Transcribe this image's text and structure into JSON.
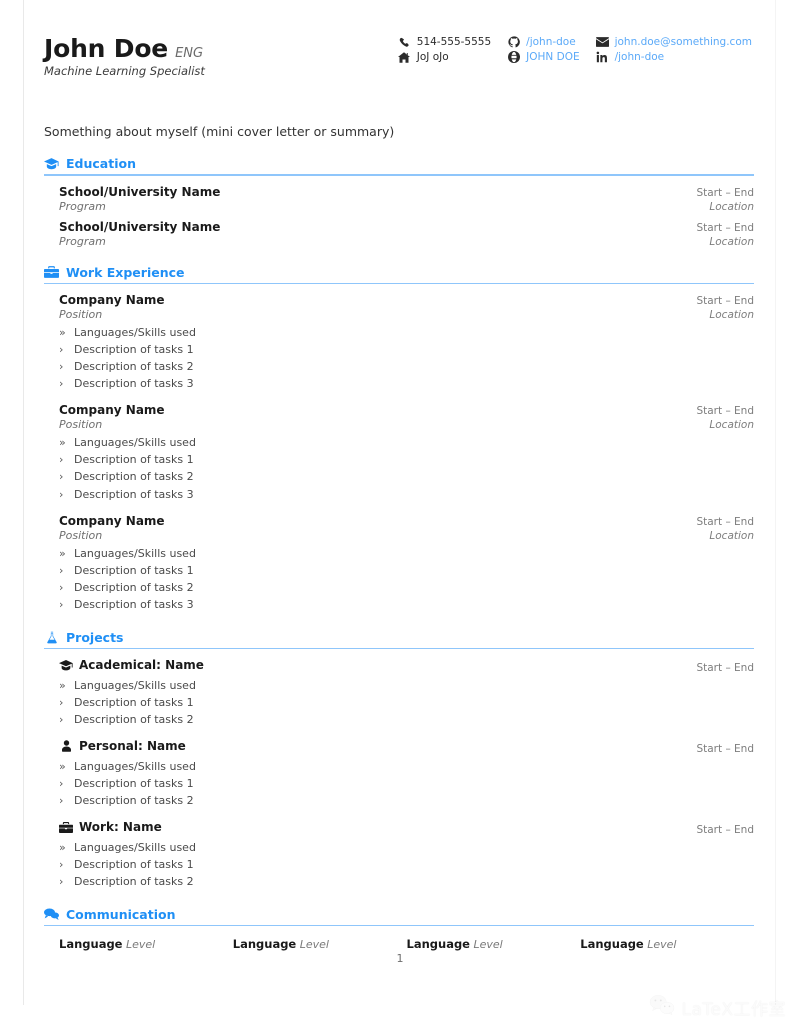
{
  "header": {
    "name": "John Doe",
    "name_tag": "ENG",
    "subtitle": "Machine Learning Specialist",
    "summary": "Something about myself (mini cover letter or summary)",
    "contacts": [
      {
        "icon": "phone-icon",
        "text": "514-555-5555",
        "style": "dark"
      },
      {
        "icon": "github-icon",
        "text": "/john-doe",
        "style": "link"
      },
      {
        "icon": "envelope-icon",
        "text": "john.doe@something.com",
        "style": "link"
      },
      {
        "icon": "home-icon",
        "text": "JoJ oJo",
        "style": "dark"
      },
      {
        "icon": "globe-icon",
        "text": "JOHN DOE",
        "style": "link"
      },
      {
        "icon": "linkedin-icon",
        "text": "/john-doe",
        "style": "link"
      }
    ]
  },
  "sections": {
    "education": {
      "icon": "graduation-cap-icon",
      "title": "Education",
      "entries": [
        {
          "title": "School/University Name",
          "role": "Program",
          "date": "Start – End",
          "location": "Location"
        },
        {
          "title": "School/University Name",
          "role": "Program",
          "date": "Start – End",
          "location": "Location"
        }
      ]
    },
    "work": {
      "icon": "briefcase-icon",
      "title": "Work Experience",
      "entries": [
        {
          "title": "Company Name",
          "role": "Position",
          "date": "Start – End",
          "location": "Location",
          "bullets": [
            {
              "mark": "»",
              "text": "Languages/Skills used"
            },
            {
              "mark": "›",
              "text": "Description of tasks 1"
            },
            {
              "mark": "›",
              "text": "Description of tasks 2"
            },
            {
              "mark": "›",
              "text": "Description of tasks 3"
            }
          ]
        },
        {
          "title": "Company Name",
          "role": "Position",
          "date": "Start – End",
          "location": "Location",
          "bullets": [
            {
              "mark": "»",
              "text": "Languages/Skills used"
            },
            {
              "mark": "›",
              "text": "Description of tasks 1"
            },
            {
              "mark": "›",
              "text": "Description of tasks 2"
            },
            {
              "mark": "›",
              "text": "Description of tasks 3"
            }
          ]
        },
        {
          "title": "Company Name",
          "role": "Position",
          "date": "Start – End",
          "location": "Location",
          "bullets": [
            {
              "mark": "»",
              "text": "Languages/Skills used"
            },
            {
              "mark": "›",
              "text": "Description of tasks 1"
            },
            {
              "mark": "›",
              "text": "Description of tasks 2"
            },
            {
              "mark": "›",
              "text": "Description of tasks 3"
            }
          ]
        }
      ]
    },
    "projects": {
      "icon": "flask-icon",
      "title": "Projects",
      "entries": [
        {
          "icon": "graduation-cap-icon",
          "title": "Academical: Name",
          "date": "Start – End",
          "bullets": [
            {
              "mark": "»",
              "text": "Languages/Skills used"
            },
            {
              "mark": "›",
              "text": "Description of tasks 1"
            },
            {
              "mark": "›",
              "text": "Description of tasks 2"
            }
          ]
        },
        {
          "icon": "person-icon",
          "title": "Personal: Name",
          "date": "Start – End",
          "bullets": [
            {
              "mark": "»",
              "text": "Languages/Skills used"
            },
            {
              "mark": "›",
              "text": "Description of tasks 1"
            },
            {
              "mark": "›",
              "text": "Description of tasks 2"
            }
          ]
        },
        {
          "icon": "briefcase-icon",
          "title": "Work: Name",
          "date": "Start – End",
          "bullets": [
            {
              "mark": "»",
              "text": "Languages/Skills used"
            },
            {
              "mark": "›",
              "text": "Description of tasks 1"
            },
            {
              "mark": "›",
              "text": "Description of tasks 2"
            }
          ]
        }
      ]
    },
    "communication": {
      "icon": "comments-icon",
      "title": "Communication",
      "languages": [
        {
          "name": "Language",
          "level": "Level"
        },
        {
          "name": "Language",
          "level": "Level"
        },
        {
          "name": "Language",
          "level": "Level"
        },
        {
          "name": "Language",
          "level": "Level"
        }
      ]
    }
  },
  "footer": {
    "page_number": "1",
    "watermark_icon": "wechat-icon",
    "watermark_text": "LaTeX工作室"
  },
  "colors": {
    "accent": "#1f8ff5",
    "rule": "#8fc6fb",
    "link": "#5aa9f8"
  }
}
